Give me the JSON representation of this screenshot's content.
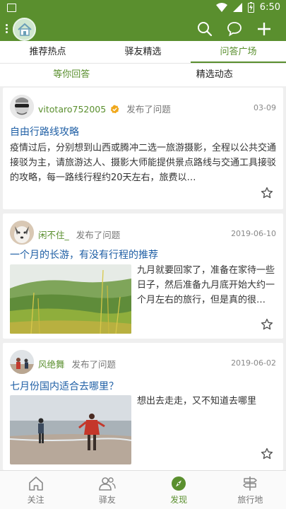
{
  "status_bar": {
    "time": "6:50"
  },
  "top_tabs": [
    {
      "label": "推荐热点"
    },
    {
      "label": "驿友精选"
    },
    {
      "label": "问答广场"
    }
  ],
  "sub_tabs": [
    {
      "label": "等你回答"
    },
    {
      "label": "精选动态"
    }
  ],
  "posts": [
    {
      "user": "vitotaro752005",
      "action": "发布了问题",
      "date": "03-09",
      "title": "自由行路线攻略",
      "body": "疫情过后，分别想到山西或腾冲二选一旅游摄影，全程以公共交通接驳为主，请旅游达人、摄影大师能提供景点路线与交通工具接驳的攻略，每一路线行程约20天左右，旅费以…"
    },
    {
      "user": "闲不住_",
      "action": "发布了问题",
      "date": "2019-06-10",
      "title": "一个月的长游，有没有行程的推荐",
      "body": "九月就要回家了，准备在家待一些日子，然后准备九月底开始大约一个月左右的旅行，但是真的很…"
    },
    {
      "user": "风绝舞",
      "action": "发布了问题",
      "date": "2019-06-02",
      "title": "七月份国内适合去哪里？",
      "body": "想出去走走，又不知道去哪里"
    }
  ],
  "bottom_nav": [
    {
      "label": "关注"
    },
    {
      "label": "驿友"
    },
    {
      "label": "发现"
    },
    {
      "label": "旅行地"
    }
  ],
  "colors": {
    "brand_green": "#5a8f2e",
    "title_blue": "#1f5fa5"
  }
}
